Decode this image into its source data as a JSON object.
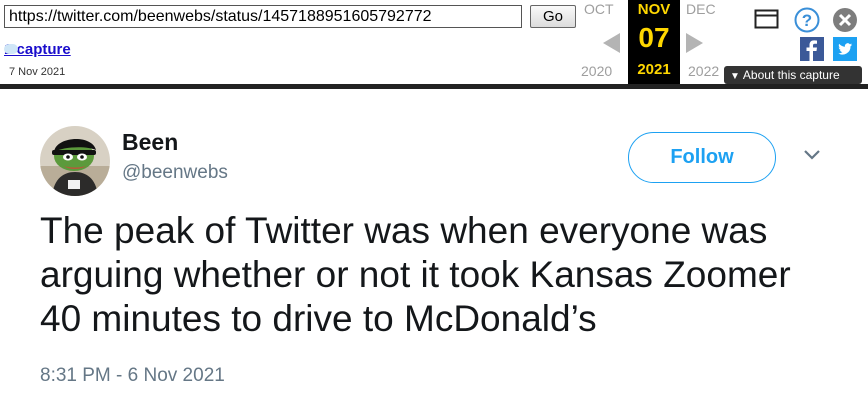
{
  "wayback": {
    "url": "https://twitter.com/beenwebs/status/1457188951605792772",
    "go_label": "Go",
    "captures_link": "1 capture",
    "capture_date": "7 Nov 2021",
    "prev_month": "OCT",
    "current_month": "NOV",
    "next_month": "DEC",
    "current_day": "07",
    "prev_year": "2020",
    "current_year": "2021",
    "next_year": "2022",
    "about_label": "About this capture",
    "accent_color": "#ffd700"
  },
  "tweet": {
    "display_name": "Been",
    "handle": "@beenwebs",
    "follow_label": "Follow",
    "text": "The peak of Twitter was when everyone was arguing whether or not it took Kansas Zoomer 40 minutes to drive to McDonald’s",
    "timestamp": "8:31 PM - 6 Nov 2021",
    "accent_color": "#1da1f2"
  },
  "icons": [
    "chevron-left-icon",
    "chevron-right-icon",
    "window-icon",
    "help-icon",
    "close-icon",
    "facebook-icon",
    "twitter-icon",
    "caret-down-icon",
    "avatar-image"
  ]
}
